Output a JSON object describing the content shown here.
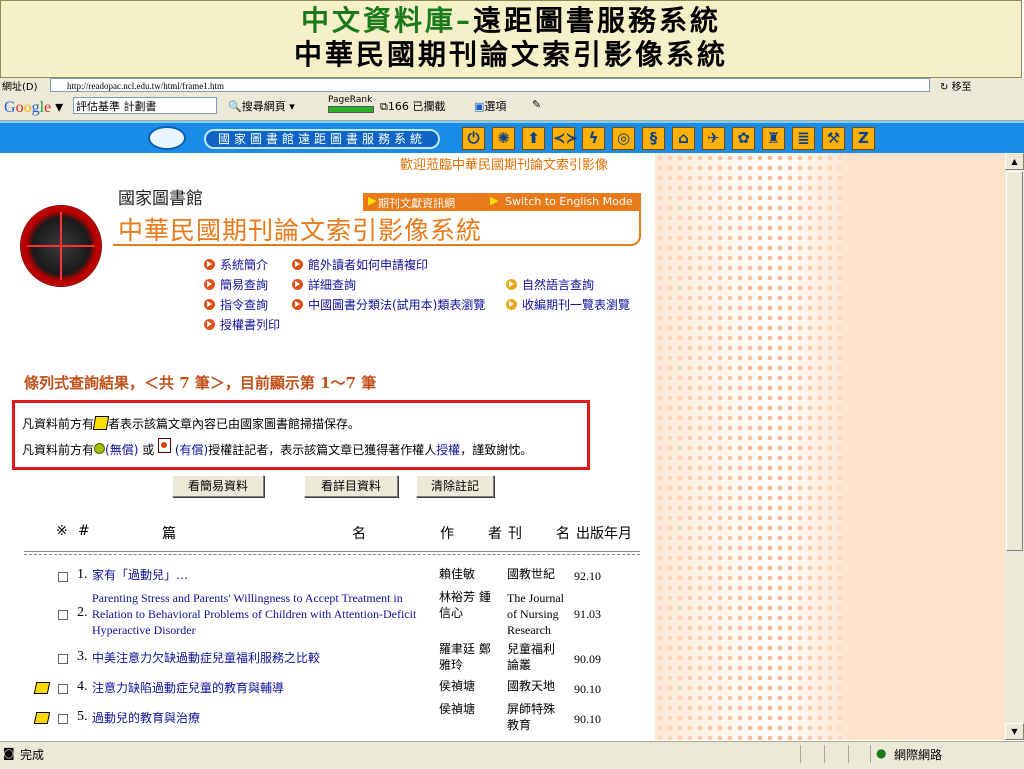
{
  "overlay_title": {
    "line1_green": "中文資料庫",
    "line1_dash": "–",
    "line1_black": "遠距圖書服務系統",
    "line2": "中華民國期刊論文索引影像系統"
  },
  "address_bar": {
    "label": "網址(D)",
    "url": "http://readopac.ncl.edu.tw/html/frame1.htm",
    "go_label": "移至"
  },
  "google_bar": {
    "logo": "Google",
    "search_value": "評估基準 計劃書",
    "search_web_label": "搜尋網頁",
    "pagerank_label": "PageRank",
    "blocked_label": "166 已攔截",
    "options_label": "選項"
  },
  "nav_bar": {
    "pill_label": "國家圖書館遠距圖書服務系統",
    "icons": [
      "power-icon",
      "sun-icon",
      "up-arrow-icon",
      "handshake-icon",
      "lightning-icon",
      "spiral-icon",
      "scroll-icon",
      "building-icon",
      "plane-icon",
      "palette-icon",
      "temple-icon",
      "book-stack-icon",
      "hammer-icon",
      "z-icon"
    ]
  },
  "welcome_text": "歡迎蒞臨中華民國期刊論文索引影像",
  "header": {
    "library_name": "國家圖書館",
    "link_periodical_info": "期刊文獻資訊網",
    "link_english": "Switch to English Mode",
    "system_title": "中華民國期刊論文索引影像系統"
  },
  "menu": {
    "intro": "系統簡介",
    "outside_copy": "館外讀者如何申請複印",
    "simple_query": "簡易查詢",
    "detailed_query": "詳細查詢",
    "natural_query": "自然語言查詢",
    "command_query": "指令查詢",
    "classification_browse": "中國圖書分類法(試用本)類表瀏覽",
    "journal_list_browse": "收編期刊一覽表瀏覽",
    "authorized_print": "授權書列印"
  },
  "result_heading": "條列式查詢結果，＜共 7 筆＞，目前顯示第 1～7 筆",
  "notice": {
    "line1_a": "凡資料前方有",
    "line1_b": "者表示該篇文章內容已由國家圖書館掃描保存。",
    "line2_a": "凡資料前方有",
    "line2_free": "(無償)",
    "line2_or": " 或 ",
    "line2_paid": "(有償)",
    "line2_b": "授權註記者，表示該篇文章已獲得著作權人",
    "line2_link": "授權",
    "line2_c": "，謹致謝忱。"
  },
  "buttons": {
    "simple_view": "看簡易資料",
    "detail_view": "看詳目資料",
    "clear_marks": "清除註記"
  },
  "table": {
    "headers": {
      "mark": "※",
      "num": "#",
      "title_a": "篇",
      "title_b": "名",
      "author_a": "作",
      "author_b": "者",
      "journal_a": "刊",
      "journal_b": "名",
      "date": "出版年月"
    },
    "rows": [
      {
        "num": "1.",
        "title": "家有「過動兒」…",
        "author": "賴佳敏",
        "journal": "國教世紀",
        "date": "92.10",
        "scanned": false
      },
      {
        "num": "2.",
        "title_l1": "Parenting Stress and Parents' Willingness to Accept Treatment in",
        "title_l2": "Relation to Behavioral Problems of Children with Attention-Deficit",
        "title_l3": "Hyperactive Disorder",
        "author_l1": "林裕芳 鍾",
        "author_l2": "信心",
        "journal_l1": "The Journal",
        "journal_l2": "of Nursing",
        "journal_l3": "Research",
        "date": "91.03",
        "scanned": false
      },
      {
        "num": "3.",
        "title": "中美注意力欠缺過動症兒童福利服務之比較",
        "author_l1": "羅聿廷 鄭",
        "author_l2": "雅玲",
        "journal_l1": "兒童福利",
        "journal_l2": "論叢",
        "date": "90.09",
        "scanned": false
      },
      {
        "num": "4.",
        "title": "注意力缺陷過動症兒童的教育與輔導",
        "author": "侯禎塘",
        "journal": "國教天地",
        "date": "90.10",
        "scanned": true
      },
      {
        "num": "5.",
        "title": "過動兒的教育與治療",
        "author": "侯禎塘",
        "journal_l1": "屏師特殊",
        "journal_l2": "教育",
        "date": "90.10",
        "scanned": true
      }
    ]
  },
  "status_bar": {
    "status": "完成",
    "zone": "網際網路"
  }
}
